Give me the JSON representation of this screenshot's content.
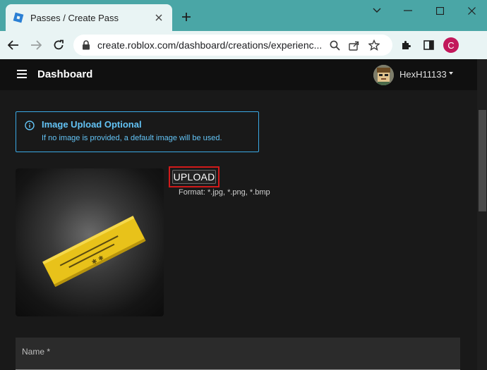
{
  "browser": {
    "tab_title": "Passes / Create Pass",
    "url": "create.roblox.com/dashboard/creations/experienc...",
    "profile_initial": "C"
  },
  "header": {
    "title": "Dashboard",
    "username": "HexH11133"
  },
  "alert": {
    "title": "Image Upload Optional",
    "message": "If no image is provided, a default image will be used."
  },
  "upload": {
    "button_label": "UPLOAD",
    "format_hint": "Format: *.jpg, *.png, *.bmp"
  },
  "form": {
    "name_label": "Name *"
  },
  "colors": {
    "tab_strip": "#4aa6a6",
    "page_bg": "#191919",
    "alert_accent": "#63c3f5",
    "highlight_box": "#d11a1a",
    "pass_ticket": "#e8c21a"
  }
}
